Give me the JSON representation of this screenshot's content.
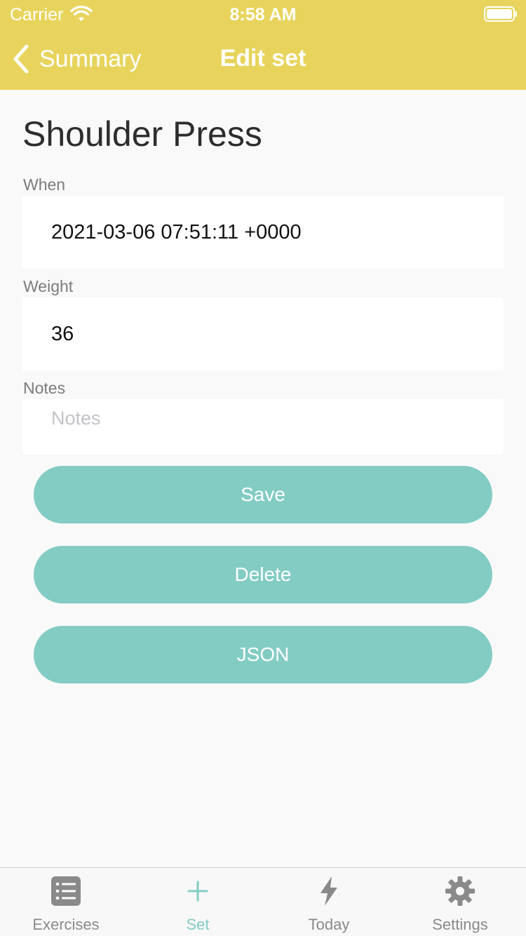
{
  "status_bar": {
    "carrier": "Carrier",
    "time": "8:58 AM"
  },
  "nav": {
    "back_label": "Summary",
    "title": "Edit set"
  },
  "exercise": {
    "name": "Shoulder Press"
  },
  "fields": {
    "when": {
      "label": "When",
      "value": "2021-03-06 07:51:11 +0000"
    },
    "weight": {
      "label": "Weight",
      "value": "36"
    },
    "notes": {
      "label": "Notes",
      "value": "",
      "placeholder": "Notes"
    }
  },
  "buttons": {
    "save": "Save",
    "delete": "Delete",
    "json": "JSON"
  },
  "tab_bar": {
    "tabs": [
      {
        "label": "Exercises",
        "icon": "list-icon"
      },
      {
        "label": "Set",
        "icon": "plus-icon",
        "active": true
      },
      {
        "label": "Today",
        "icon": "lightning-icon"
      },
      {
        "label": "Settings",
        "icon": "gear-icon"
      }
    ]
  },
  "colors": {
    "header": "#e8d45c",
    "accent": "#83ccc4",
    "background": "#f9f9f9"
  }
}
